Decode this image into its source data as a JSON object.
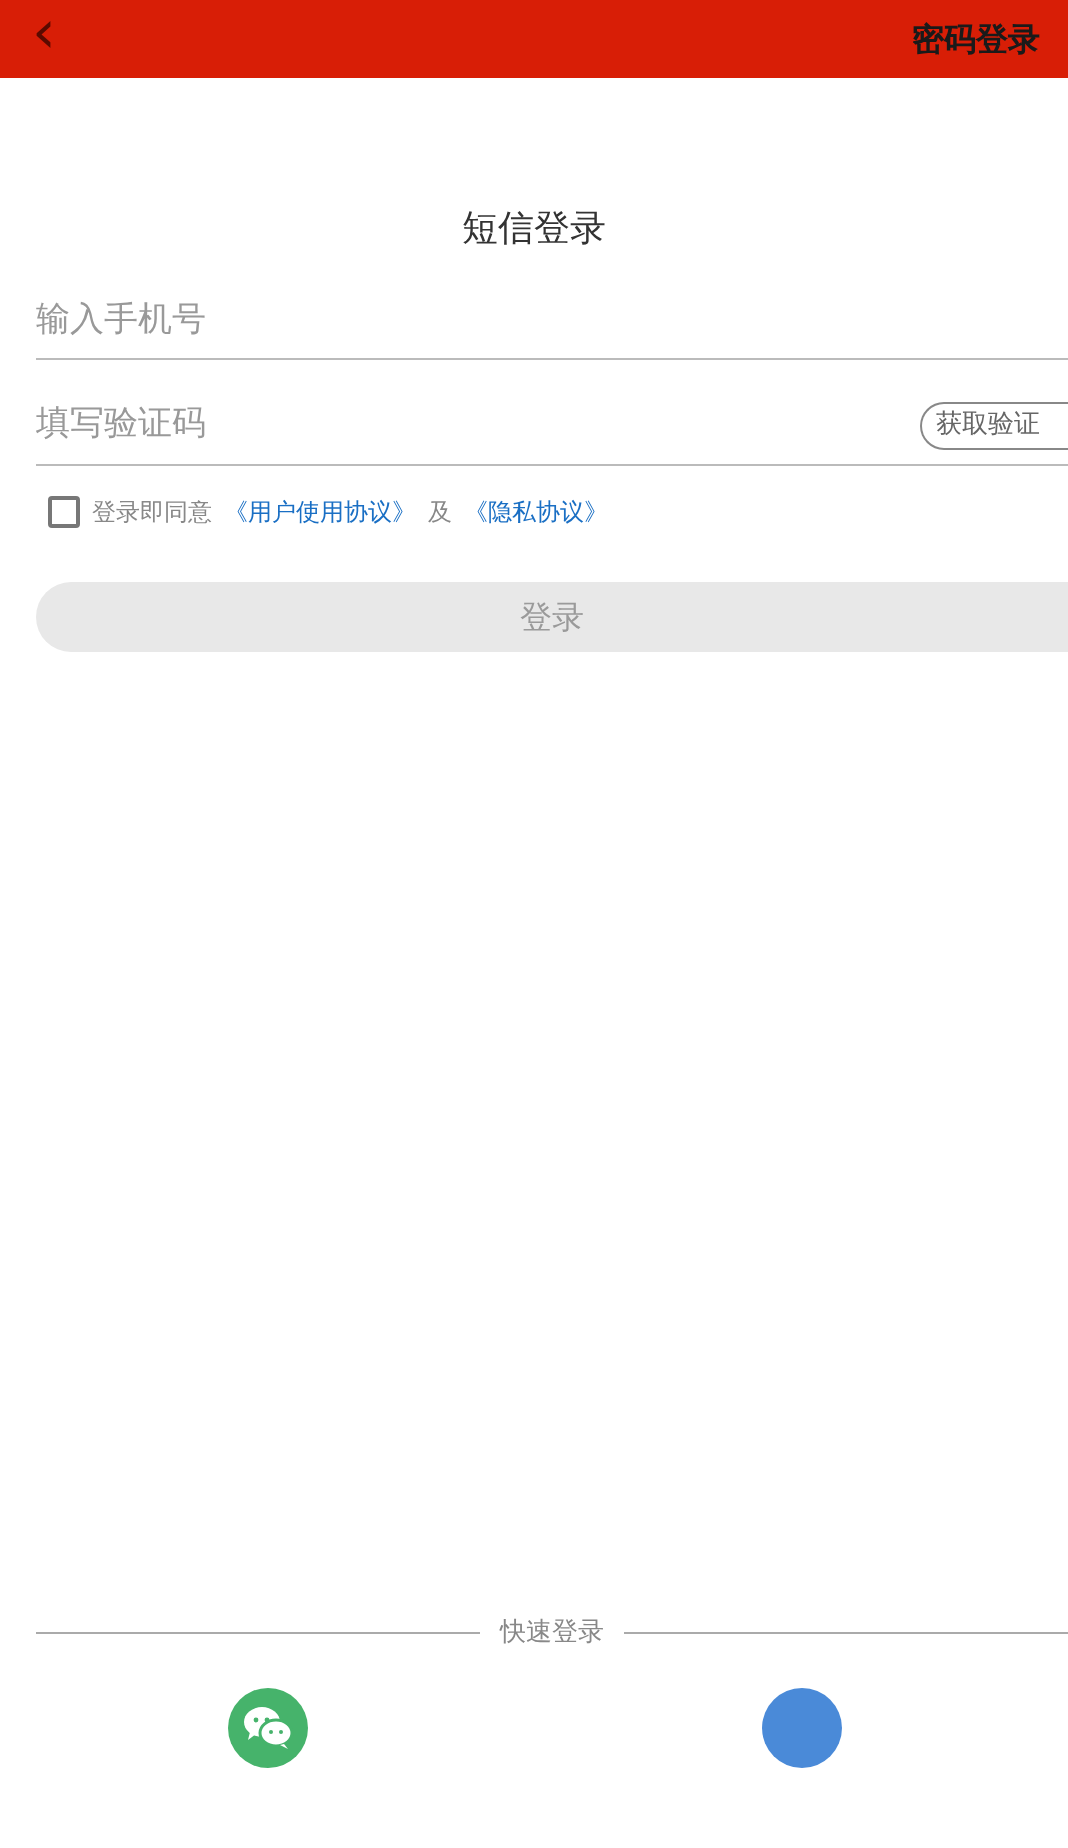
{
  "header": {
    "back": "‹",
    "action": "密码登录"
  },
  "title": "短信登录",
  "phone_field": {
    "placeholder": "输入手机号"
  },
  "code_field": {
    "placeholder": "填写验证码",
    "button": "获取验证"
  },
  "agreement": {
    "checked": false,
    "prefix": "登录即同意",
    "link_1": "《用户使用协议》",
    "joiner": "及",
    "link_2": "《隐私协议》"
  },
  "login_button": {
    "label": "登录",
    "disabled": true
  },
  "quick_login": {
    "title": "快速登录",
    "options": [
      {
        "kind": "chat",
        "color": "#46b36b"
      },
      {
        "kind": "plain",
        "color": "#4a8ad8"
      }
    ]
  }
}
